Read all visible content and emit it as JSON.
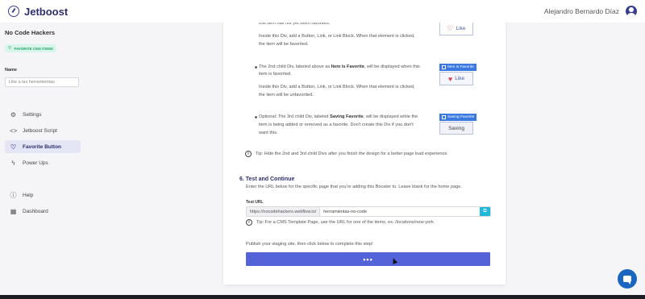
{
  "header": {
    "brand": "Jetboost",
    "user_name": "Alejandro Bernardo Díaz"
  },
  "sidebar": {
    "project_name": "No Code Hackers",
    "project_badge": "FAVORITE CMS ITEMS",
    "name_label": "Name",
    "name_value": "Like a las herramientas",
    "items": [
      {
        "label": "Settings",
        "icon": "gear-icon"
      },
      {
        "label": "Jetboost Script",
        "icon": "code-icon"
      },
      {
        "label": "Favorite Button",
        "icon": "heart-icon"
      },
      {
        "label": "Power Ups",
        "icon": "bolt-icon"
      }
    ],
    "lower_items": [
      {
        "label": "Help",
        "icon": "help-icon"
      },
      {
        "label": "Dashboard",
        "icon": "grid-icon"
      }
    ]
  },
  "content": {
    "b1_line1": "this item has not yet been favorited.",
    "b1_line2": "Inside this Div, add a Button, Link, or Link Block. When that element is clicked,",
    "b1_line3": "the item will be favorited.",
    "b2_pre": "The 2nd child Div, labeled above as ",
    "b2_strong": "Item is Favorite",
    "b2_post": ", will be displayed when this",
    "b2_line2": "item is favorited.",
    "b2_line3": "Inside this Div, add a Button, Link, or Link Block. When that element is clicked,",
    "b2_line4": "the item will be unfavorited.",
    "b3_pre": "Optional: The 3rd child Div, labeled ",
    "b3_strong": "Saving Favorite",
    "b3_post": ", will be displayed while the",
    "b3_line2": "item is being added or removed as a favorite. Don't create this Div if you don't",
    "b3_line3": "want this.",
    "tip1": "Tip: Hide the 2nd and 3rd child Divs after you finish the design for a better page load experience.",
    "demo_like1": "Like",
    "demo_tag1": "Item is Favorite",
    "demo_like2": "Like",
    "demo_tag2": "Saving Favorite",
    "demo_saving": "Saving"
  },
  "step": {
    "title": "6. Test and Continue",
    "description": "Enter the URL below for the specific page that you're adding this Booster to. Leave blank for the home page.",
    "url_label": "Test URL",
    "url_prefix": "https://nocodehackers.webflow.io/",
    "url_value": "herramientas-no-code",
    "tip2": "Tip: For a CMS Template Page, use the URL for one of the items, ex. /locations/new-york",
    "publish_text": "Publish your staging site, then click below to complete this step!",
    "complete_label": "•••"
  },
  "colors": {
    "brand": "#2d2f6e",
    "accent": "#5463d8",
    "badge_green": "#22a06b",
    "tag_blue": "#3a7ae0",
    "heart_red": "#d9475a",
    "chat_blue": "#1a65c0"
  }
}
